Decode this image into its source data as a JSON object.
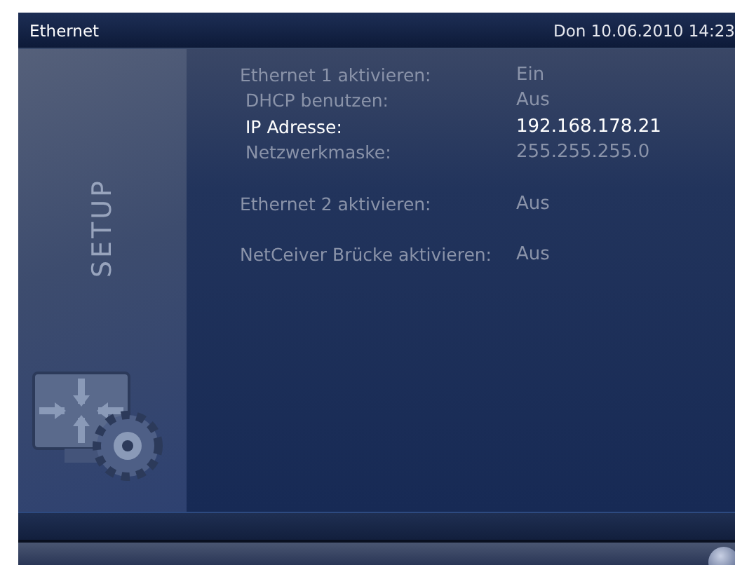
{
  "title_bar": {
    "title": "Ethernet",
    "datetime": "Don 10.06.2010 14:23"
  },
  "sidebar": {
    "label": "SETUP"
  },
  "setting_groups": [
    [
      {
        "label": "Ethernet 1 aktivieren:",
        "value": "Ein",
        "indent": false,
        "selected": false
      },
      {
        "label": "DHCP benutzen:",
        "value": "Aus",
        "indent": true,
        "selected": false
      },
      {
        "label": "IP Adresse:",
        "value": "192.168.178.21",
        "indent": true,
        "selected": true
      },
      {
        "label": "Netzwerkmaske:",
        "value": "255.255.255.0",
        "indent": true,
        "selected": false
      }
    ],
    [
      {
        "label": "Ethernet 2 aktivieren:",
        "value": "Aus",
        "indent": false,
        "selected": false
      }
    ],
    [
      {
        "label": "NetCeiver Brücke aktivieren:",
        "value": "Aus",
        "indent": false,
        "selected": false
      }
    ]
  ]
}
